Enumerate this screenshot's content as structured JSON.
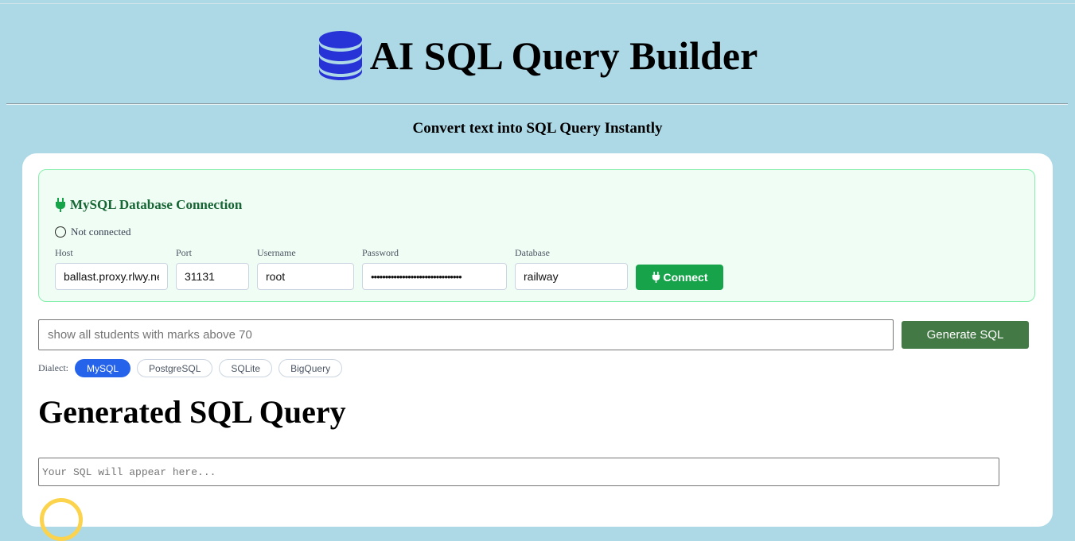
{
  "header": {
    "title": "AI SQL Query Builder",
    "subtitle": "Convert text into SQL Query Instantly",
    "icon": "database-icon"
  },
  "connection": {
    "title": "MySQL Database Connection",
    "status": "Not connected",
    "fields": {
      "host": {
        "label": "Host",
        "value": "ballast.proxy.rlwy.net"
      },
      "port": {
        "label": "Port",
        "value": "31131"
      },
      "username": {
        "label": "Username",
        "value": "root"
      },
      "password": {
        "label": "Password",
        "value": "••••••••••••••••••••••••••••••••"
      },
      "database": {
        "label": "Database",
        "value": "railway"
      }
    },
    "connect_label": "Connect"
  },
  "query": {
    "placeholder": "show all students with marks above 70",
    "generate_label": "Generate SQL"
  },
  "dialect": {
    "label": "Dialect:",
    "options": [
      "MySQL",
      "PostgreSQL",
      "SQLite",
      "BigQuery"
    ],
    "selected": "MySQL"
  },
  "output": {
    "title": "Generated SQL Query",
    "placeholder": "Your SQL will appear here..."
  },
  "colors": {
    "background": "#add8e6",
    "accent_blue": "#2563eb",
    "connect_green": "#16a34a",
    "generate_green": "#437945"
  }
}
